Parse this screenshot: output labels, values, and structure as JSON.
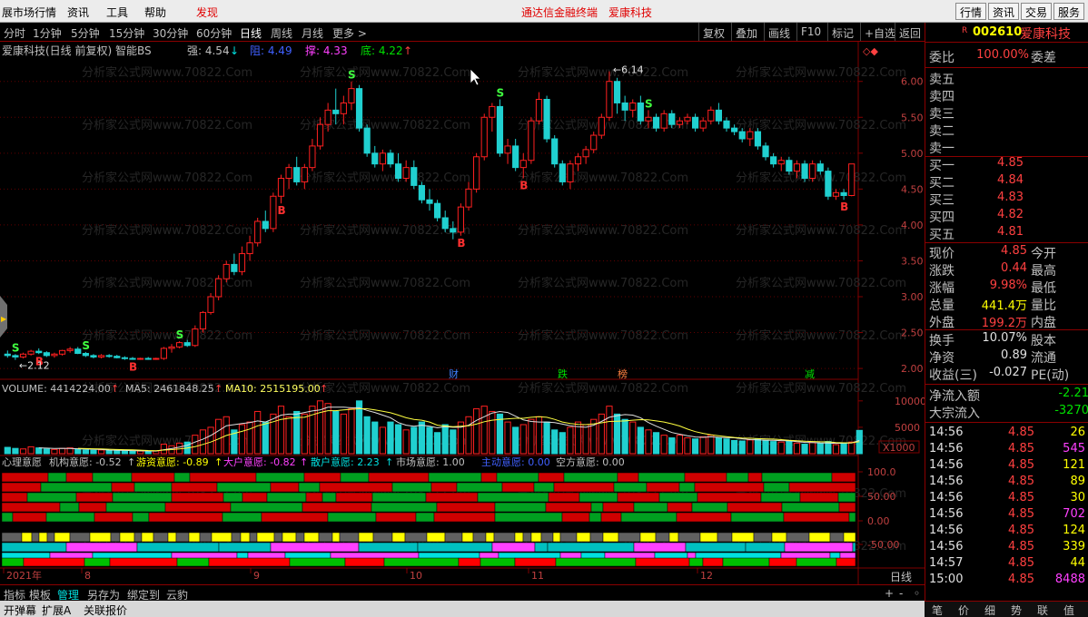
{
  "menu": {
    "items": [
      "展市场行情",
      "资讯",
      "工具",
      "帮助",
      "发现"
    ],
    "center_text": [
      "通达信金融终端",
      "爱康科技"
    ],
    "right_buttons": [
      "行情",
      "资讯",
      "交易",
      "服务"
    ]
  },
  "period_bar": {
    "periods": [
      "分时",
      "1分钟",
      "5分钟",
      "15分钟",
      "30分钟",
      "60分钟",
      "日线",
      "周线",
      "月线",
      "更多 >"
    ],
    "active": "日线",
    "tools": [
      "复权",
      "叠加",
      "画线",
      "F10",
      "标记",
      "+自选",
      "返回"
    ]
  },
  "chart_header": {
    "title": "爱康科技(日线 前复权) 智能BS",
    "indicators": [
      {
        "label": "强: 4.54",
        "arrow": "↓",
        "color": "#c0c0c0"
      },
      {
        "label": "阻: 4.49",
        "arrow": "",
        "color": "#4060ff"
      },
      {
        "label": "撑: 4.33",
        "arrow": "",
        "color": "#ff40ff"
      },
      {
        "label": "底: 4.22",
        "arrow": "↑",
        "color": "#00e000"
      }
    ]
  },
  "watermark": "分析家公式网www.70822.Com",
  "price_axis": [
    "6.00",
    "5.50",
    "5.00",
    "4.50",
    "4.00",
    "3.50",
    "3.00",
    "2.50",
    "2.00"
  ],
  "price_annotations": {
    "high": "6.14",
    "low": "2.12"
  },
  "event_markers": [
    {
      "label": "财",
      "color": "#4080ff"
    },
    {
      "label": "跌",
      "color": "#00e000"
    },
    {
      "label": "榜",
      "color": "#ff8040"
    },
    {
      "label": "减",
      "color": "#00e000"
    }
  ],
  "volume_header": {
    "volume": "VOLUME: 4414224.00",
    "ma5": "MA5: 2461848.25",
    "ma10": "MA10: 2515195.00"
  },
  "volume_axis": [
    "10000",
    "5000",
    "X1000"
  ],
  "sentiment_header": [
    {
      "label": "心理意愿",
      "color": "#c0c0c0"
    },
    {
      "label": "机构意愿: -0.52",
      "color": "#c0c0c0"
    },
    {
      "label": "游资意愿: -0.89",
      "color": "#ffff00"
    },
    {
      "label": "大户意愿: -0.82",
      "color": "#ff40ff"
    },
    {
      "label": "散户意愿: 2.23",
      "color": "#00e0e0"
    },
    {
      "label": "市场意愿: 1.00",
      "color": "#c0c0c0"
    },
    {
      "label": "主动意愿: 0.00",
      "color": "#4060ff"
    },
    {
      "label": "空方意愿: 0.00",
      "color": "#c0c0c0"
    }
  ],
  "sentiment_axis": [
    "100.0",
    "50.00",
    "0.00",
    "-50.00"
  ],
  "date_axis": [
    "2021年",
    "8",
    "9",
    "10",
    "11",
    "12"
  ],
  "date_axis_label": "日线",
  "chart_data": {
    "type": "candlestick",
    "title": "爱康科技(日线 前复权) 智能BS",
    "ylim": [
      1.9,
      6.3
    ],
    "candles": [
      [
        2.2,
        2.25,
        2.15,
        2.18
      ],
      [
        2.18,
        2.2,
        2.12,
        2.16
      ],
      [
        2.16,
        2.22,
        2.14,
        2.2
      ],
      [
        2.2,
        2.26,
        2.18,
        2.24
      ],
      [
        2.24,
        2.28,
        2.2,
        2.22
      ],
      [
        2.22,
        2.24,
        2.16,
        2.18
      ],
      [
        2.18,
        2.22,
        2.15,
        2.2
      ],
      [
        2.2,
        2.26,
        2.18,
        2.25
      ],
      [
        2.25,
        2.3,
        2.22,
        2.27
      ],
      [
        2.27,
        2.3,
        2.2,
        2.21
      ],
      [
        2.21,
        2.23,
        2.16,
        2.18
      ],
      [
        2.18,
        2.2,
        2.14,
        2.16
      ],
      [
        2.16,
        2.2,
        2.14,
        2.18
      ],
      [
        2.18,
        2.2,
        2.15,
        2.17
      ],
      [
        2.17,
        2.19,
        2.14,
        2.15
      ],
      [
        2.15,
        2.17,
        2.12,
        2.14
      ],
      [
        2.14,
        2.16,
        2.12,
        2.13
      ],
      [
        2.13,
        2.15,
        2.12,
        2.14
      ],
      [
        2.14,
        2.16,
        2.12,
        2.13
      ],
      [
        2.13,
        2.15,
        2.12,
        2.14
      ],
      [
        2.14,
        2.3,
        2.12,
        2.28
      ],
      [
        2.28,
        2.34,
        2.22,
        2.3
      ],
      [
        2.3,
        2.38,
        2.28,
        2.36
      ],
      [
        2.36,
        2.4,
        2.3,
        2.32
      ],
      [
        2.32,
        2.6,
        2.3,
        2.55
      ],
      [
        2.55,
        2.8,
        2.5,
        2.78
      ],
      [
        2.78,
        3.05,
        2.75,
        3.0
      ],
      [
        3.0,
        3.3,
        2.95,
        3.25
      ],
      [
        3.25,
        3.5,
        3.2,
        3.45
      ],
      [
        3.45,
        3.6,
        3.3,
        3.35
      ],
      [
        3.35,
        3.7,
        3.3,
        3.6
      ],
      [
        3.6,
        3.85,
        3.5,
        3.75
      ],
      [
        3.75,
        4.1,
        3.7,
        4.05
      ],
      [
        4.05,
        4.2,
        3.9,
        3.95
      ],
      [
        3.95,
        4.45,
        3.9,
        4.4
      ],
      [
        4.4,
        4.7,
        4.3,
        4.65
      ],
      [
        4.65,
        4.85,
        4.5,
        4.8
      ],
      [
        4.8,
        4.95,
        4.55,
        4.6
      ],
      [
        4.6,
        4.85,
        4.5,
        4.8
      ],
      [
        4.8,
        5.2,
        4.75,
        5.1
      ],
      [
        5.1,
        5.5,
        5.05,
        5.4
      ],
      [
        5.4,
        5.7,
        5.3,
        5.6
      ],
      [
        5.6,
        5.9,
        5.4,
        5.55
      ],
      [
        5.55,
        5.8,
        5.4,
        5.7
      ],
      [
        5.7,
        6.0,
        5.6,
        5.9
      ],
      [
        5.9,
        5.95,
        5.3,
        5.35
      ],
      [
        5.35,
        5.4,
        4.95,
        5.0
      ],
      [
        5.0,
        5.1,
        4.8,
        4.85
      ],
      [
        4.85,
        5.05,
        4.75,
        5.0
      ],
      [
        5.0,
        5.05,
        4.8,
        4.85
      ],
      [
        4.85,
        5.0,
        4.6,
        4.65
      ],
      [
        4.65,
        4.9,
        4.6,
        4.8
      ],
      [
        4.8,
        4.9,
        4.5,
        4.55
      ],
      [
        4.55,
        4.6,
        4.3,
        4.35
      ],
      [
        4.35,
        4.5,
        4.2,
        4.3
      ],
      [
        4.3,
        4.35,
        4.05,
        4.1
      ],
      [
        4.1,
        4.2,
        3.9,
        3.95
      ],
      [
        3.95,
        4.05,
        3.8,
        3.9
      ],
      [
        3.9,
        4.3,
        3.85,
        4.25
      ],
      [
        4.25,
        4.6,
        4.2,
        4.5
      ],
      [
        4.5,
        5.0,
        4.45,
        4.95
      ],
      [
        4.95,
        5.55,
        4.9,
        5.5
      ],
      [
        5.5,
        5.7,
        5.3,
        5.65
      ],
      [
        5.65,
        5.75,
        4.95,
        5.0
      ],
      [
        5.0,
        5.2,
        4.85,
        5.1
      ],
      [
        5.1,
        5.2,
        4.75,
        4.8
      ],
      [
        4.8,
        5.0,
        4.65,
        4.9
      ],
      [
        4.9,
        5.5,
        4.85,
        5.45
      ],
      [
        5.45,
        5.85,
        5.4,
        5.75
      ],
      [
        5.75,
        5.8,
        5.15,
        5.2
      ],
      [
        5.2,
        5.25,
        4.8,
        4.85
      ],
      [
        4.85,
        4.9,
        4.55,
        4.6
      ],
      [
        4.6,
        4.9,
        4.5,
        4.85
      ],
      [
        4.85,
        5.0,
        4.75,
        4.95
      ],
      [
        4.95,
        5.1,
        4.85,
        5.05
      ],
      [
        5.05,
        5.3,
        5.0,
        5.25
      ],
      [
        5.25,
        5.55,
        5.2,
        5.5
      ],
      [
        5.5,
        6.14,
        5.45,
        6.0
      ],
      [
        6.0,
        6.05,
        5.55,
        5.7
      ],
      [
        5.7,
        5.8,
        5.45,
        5.6
      ],
      [
        5.6,
        5.75,
        5.5,
        5.7
      ],
      [
        5.7,
        5.8,
        5.4,
        5.45
      ],
      [
        5.45,
        5.6,
        5.35,
        5.5
      ],
      [
        5.5,
        5.55,
        5.3,
        5.35
      ],
      [
        5.35,
        5.6,
        5.3,
        5.55
      ],
      [
        5.55,
        5.6,
        5.35,
        5.4
      ],
      [
        5.4,
        5.5,
        5.35,
        5.45
      ],
      [
        5.45,
        5.55,
        5.4,
        5.5
      ],
      [
        5.5,
        5.55,
        5.3,
        5.35
      ],
      [
        5.35,
        5.5,
        5.3,
        5.45
      ],
      [
        5.45,
        5.65,
        5.4,
        5.6
      ],
      [
        5.6,
        5.7,
        5.4,
        5.45
      ],
      [
        5.45,
        5.5,
        5.3,
        5.35
      ],
      [
        5.35,
        5.4,
        5.25,
        5.3
      ],
      [
        5.3,
        5.35,
        5.15,
        5.2
      ],
      [
        5.2,
        5.35,
        5.1,
        5.3
      ],
      [
        5.3,
        5.35,
        5.05,
        5.1
      ],
      [
        5.1,
        5.15,
        4.9,
        4.95
      ],
      [
        4.95,
        5.0,
        4.8,
        4.85
      ],
      [
        4.85,
        4.95,
        4.75,
        4.9
      ],
      [
        4.9,
        4.95,
        4.7,
        4.75
      ],
      [
        4.75,
        4.9,
        4.65,
        4.85
      ],
      [
        4.85,
        4.9,
        4.6,
        4.65
      ],
      [
        4.65,
        4.9,
        4.6,
        4.85
      ],
      [
        4.85,
        4.9,
        4.7,
        4.75
      ],
      [
        4.75,
        4.8,
        4.35,
        4.4
      ],
      [
        4.4,
        4.5,
        4.35,
        4.45
      ],
      [
        4.45,
        4.5,
        4.35,
        4.41
      ],
      [
        4.41,
        4.85,
        4.4,
        4.85
      ]
    ],
    "signals": [
      {
        "type": "S",
        "candle": 1
      },
      {
        "type": "B",
        "candle": 4
      },
      {
        "type": "S",
        "candle": 10
      },
      {
        "type": "B",
        "candle": 16
      },
      {
        "type": "S",
        "candle": 22
      },
      {
        "type": "B",
        "candle": 35
      },
      {
        "type": "S",
        "candle": 44
      },
      {
        "type": "B",
        "candle": 58
      },
      {
        "type": "S",
        "candle": 63
      },
      {
        "type": "B",
        "candle": 66
      },
      {
        "type": "S",
        "candle": 82
      },
      {
        "type": "B",
        "candle": 107
      }
    ],
    "volume": [
      1200,
      1000,
      900,
      1300,
      1100,
      900,
      800,
      1000,
      1100,
      800,
      700,
      650,
      700,
      600,
      650,
      500,
      450,
      500,
      480,
      520,
      1800,
      1500,
      2000,
      2200,
      3500,
      4500,
      5000,
      6500,
      7000,
      4500,
      5500,
      6000,
      8000,
      6000,
      7500,
      9000,
      7000,
      8000,
      7500,
      9000,
      10000,
      9500,
      8000,
      7500,
      8500,
      10000,
      7000,
      6000,
      5000,
      6000,
      5500,
      4500,
      5000,
      6000,
      5000,
      4000,
      5500,
      4500,
      6000,
      7000,
      8500,
      9000,
      8000,
      7500,
      6000,
      5000,
      5500,
      6500,
      7000,
      6000,
      4500,
      4000,
      5000,
      6000,
      5500,
      6500,
      7500,
      9000,
      7500,
      6500,
      6000,
      5000,
      4500,
      4000,
      3500,
      3000,
      3500,
      3000,
      2800,
      3200,
      3500,
      3000,
      2800,
      2500,
      2400,
      2600,
      2800,
      2500,
      2300,
      2200,
      2400,
      2000,
      1800,
      2100,
      1900,
      2300,
      1700,
      2000,
      2200,
      4414
    ],
    "ma5_label": "MA5",
    "ma10_label": "MA10"
  },
  "panel": {
    "code": "002610",
    "name": "爱康科技",
    "r_badge": "R",
    "wei": {
      "label": "委比",
      "value": "100.00%",
      "label2": "委差"
    },
    "sells": [
      "卖五",
      "卖四",
      "卖三",
      "卖二",
      "卖一"
    ],
    "buys": [
      {
        "label": "买一",
        "price": "4.85"
      },
      {
        "label": "买二",
        "price": "4.84"
      },
      {
        "label": "买三",
        "price": "4.83"
      },
      {
        "label": "买四",
        "price": "4.82"
      },
      {
        "label": "买五",
        "price": "4.81"
      }
    ],
    "quote": [
      {
        "label": "现价",
        "value": "4.85",
        "color": "#ff4040",
        "label2": "今开"
      },
      {
        "label": "涨跌",
        "value": "0.44",
        "color": "#ff4040",
        "label2": "最高"
      },
      {
        "label": "涨幅",
        "value": "9.98%",
        "color": "#ff4040",
        "label2": "最低"
      },
      {
        "label": "总量",
        "value": "441.4万",
        "color": "#ffff00",
        "label2": "量比"
      },
      {
        "label": "外盘",
        "value": "199.2万",
        "color": "#ff4040",
        "label2": "内盘"
      }
    ],
    "stats": [
      {
        "label": "换手",
        "value": "10.07%",
        "label2": "股本"
      },
      {
        "label": "净资",
        "value": "0.89",
        "label2": "流通"
      },
      {
        "label": "收益(三)",
        "value": "-0.027",
        "label2": "PE(动)"
      }
    ],
    "flows": [
      {
        "label": "净流入额",
        "value": "-2.21"
      },
      {
        "label": "大宗流入",
        "value": "-3270"
      }
    ],
    "ticks": [
      {
        "time": "14:56",
        "price": "4.85",
        "vol": "26",
        "vcolor": "#ffff00"
      },
      {
        "time": "14:56",
        "price": "4.85",
        "vol": "545",
        "vcolor": "#ff40ff"
      },
      {
        "time": "14:56",
        "price": "4.85",
        "vol": "121",
        "vcolor": "#ffff00"
      },
      {
        "time": "14:56",
        "price": "4.85",
        "vol": "89",
        "vcolor": "#ffff00"
      },
      {
        "time": "14:56",
        "price": "4.85",
        "vol": "30",
        "vcolor": "#ffff00"
      },
      {
        "time": "14:56",
        "price": "4.85",
        "vol": "702",
        "vcolor": "#ff40ff"
      },
      {
        "time": "14:56",
        "price": "4.85",
        "vol": "124",
        "vcolor": "#ffff00"
      },
      {
        "time": "14:56",
        "price": "4.85",
        "vol": "339",
        "vcolor": "#ffff00"
      },
      {
        "time": "14:57",
        "price": "4.85",
        "vol": "44",
        "vcolor": "#ffff00"
      },
      {
        "time": "15:00",
        "price": "4.85",
        "vol": "8488",
        "vcolor": "#ff40ff"
      }
    ],
    "tabs": [
      "笔",
      "价",
      "细",
      "势",
      "联",
      "值"
    ]
  },
  "bottom_tabs": [
    "指标",
    "模板",
    "管理",
    "另存为",
    "绑定到",
    "云豹"
  ],
  "bottom_active": "管理",
  "status": [
    "开弹幕",
    "扩展A",
    "关联报价"
  ],
  "colors": {
    "up": "#ff2020",
    "down": "#20d0d0",
    "grid": "#800000",
    "bg": "#000000"
  }
}
